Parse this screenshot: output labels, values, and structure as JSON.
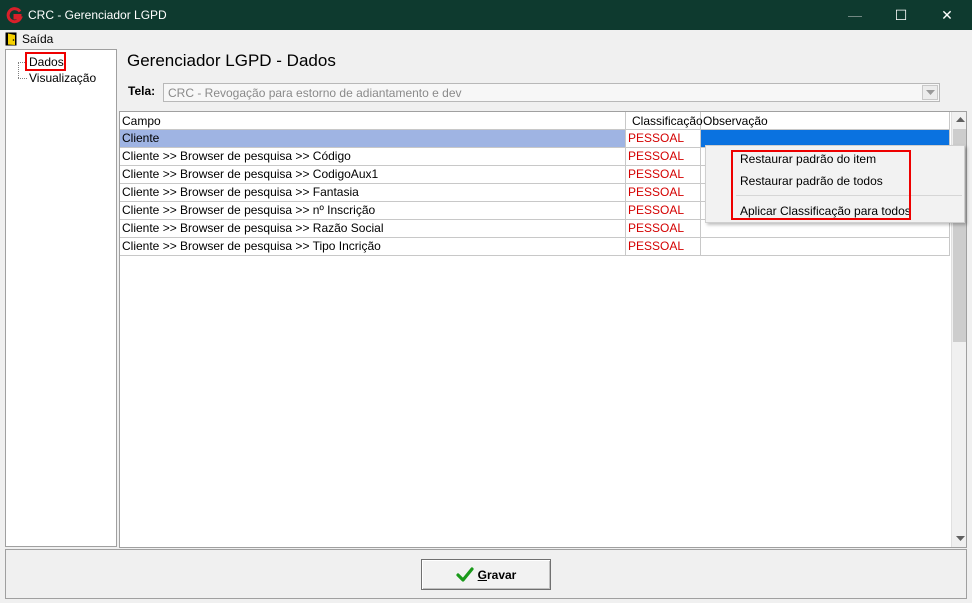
{
  "window": {
    "title": "CRC - Gerenciador LGPD",
    "minimize_glyph": "—",
    "maximize_glyph": "☐",
    "close_glyph": "✕"
  },
  "menu": {
    "saida_label": "Saída",
    "icons": {
      "saida": "door-exit-icon"
    }
  },
  "tree": {
    "items": [
      {
        "label": "Dados",
        "selected": true
      },
      {
        "label": "Visualização",
        "selected": false
      }
    ]
  },
  "main": {
    "title": "Gerenciador LGPD - Dados",
    "tela_label": "Tela:",
    "tela_value": "CRC - Revogação para estorno de adiantamento e dev"
  },
  "grid": {
    "columns": [
      "Campo",
      "Classificação",
      "Observação"
    ],
    "rows": [
      {
        "campo": "Cliente",
        "classificacao": "PESSOAL",
        "observacao": ""
      },
      {
        "campo": "Cliente >> Browser de pesquisa >> Código",
        "classificacao": "PESSOAL",
        "observacao": ""
      },
      {
        "campo": "Cliente >> Browser de pesquisa >> CodigoAux1",
        "classificacao": "PESSOAL",
        "observacao": ""
      },
      {
        "campo": "Cliente >> Browser de pesquisa >> Fantasia",
        "classificacao": "PESSOAL",
        "observacao": ""
      },
      {
        "campo": "Cliente >> Browser de pesquisa >> nº Inscrição",
        "classificacao": "PESSOAL",
        "observacao": ""
      },
      {
        "campo": "Cliente >> Browser de pesquisa >> Razão Social",
        "classificacao": "PESSOAL",
        "observacao": ""
      },
      {
        "campo": "Cliente >> Browser de pesquisa >> Tipo Incrição",
        "classificacao": "PESSOAL",
        "observacao": ""
      }
    ]
  },
  "context_menu": {
    "items": [
      "Restaurar padrão do item",
      "Restaurar padrão de todos",
      "Aplicar Classificação para todos"
    ]
  },
  "footer": {
    "gravar_first": "G",
    "gravar_rest": "ravar"
  },
  "colors": {
    "titlebar": "#0e3a2f",
    "classificacao_text": "#d40000",
    "selected_row": "#9fb4e3",
    "selected_cell": "#0a72e0",
    "highlight_box": "#e00000",
    "check_green": "#1a9a1a"
  }
}
